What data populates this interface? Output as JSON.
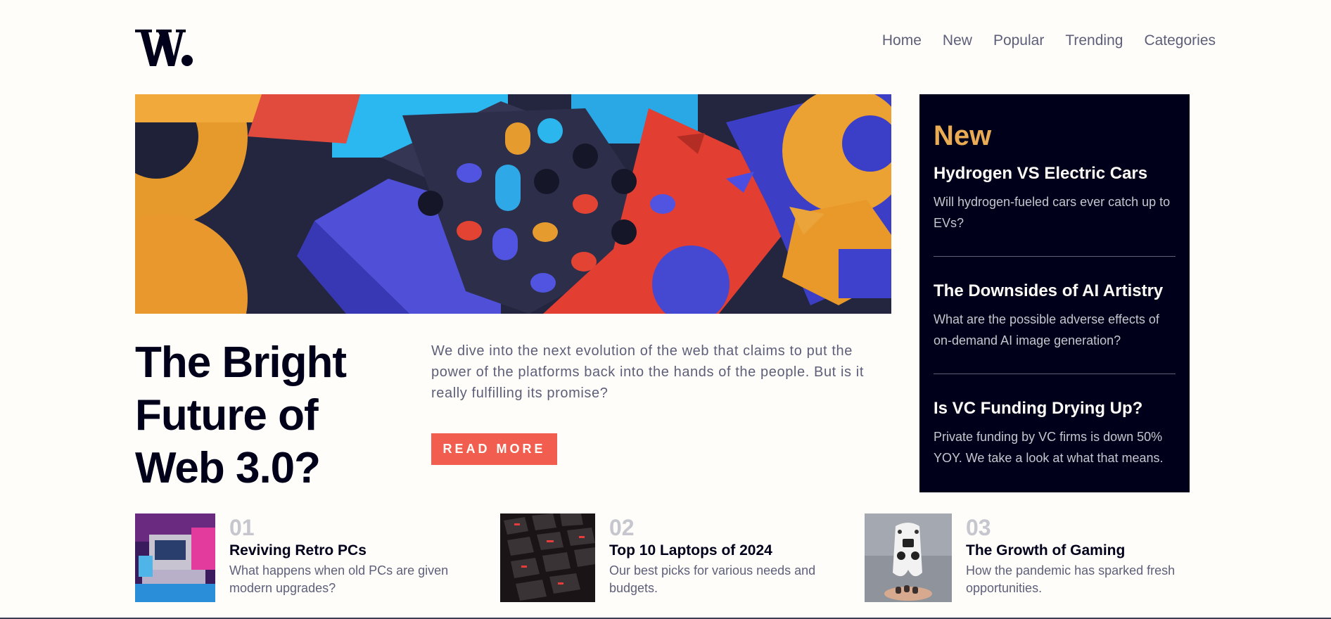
{
  "logo": {
    "text": "W."
  },
  "nav": {
    "items": [
      "Home",
      "New",
      "Popular",
      "Trending",
      "Categories"
    ]
  },
  "hero": {
    "title": "The Bright Future of Web 3.0?",
    "description": "We dive into the next evolution of the web that claims to put the power of the platforms back into the hands of the people. But is it really fulfilling its promise?",
    "button_label": "READ MORE"
  },
  "new_panel": {
    "heading": "New",
    "items": [
      {
        "title": "Hydrogen VS Electric Cars",
        "text": "Will hydrogen-fueled cars ever catch up to EVs?"
      },
      {
        "title": "The Downsides of AI Artistry",
        "text": "What are the possible adverse effects of on-demand AI image generation?"
      },
      {
        "title": "Is VC Funding Drying Up?",
        "text": "Private funding by VC firms is down 50% YOY. We take a look at what that means."
      }
    ]
  },
  "articles": [
    {
      "number": "01",
      "title": "Reviving Retro PCs",
      "text": "What happens when old PCs are given modern upgrades?"
    },
    {
      "number": "02",
      "title": "Top 10 Laptops of 2024",
      "text": "Our best picks for various needs and budgets."
    },
    {
      "number": "03",
      "title": "The Growth of Gaming",
      "text": "How the pandemic has sparked fresh opportunities."
    }
  ],
  "colors": {
    "background": "#fffdf9",
    "dark": "#00001a",
    "accent_red": "#f15e50",
    "accent_orange": "#e9ab53",
    "muted": "#5d5f79",
    "light_muted": "#c5c6ce"
  }
}
